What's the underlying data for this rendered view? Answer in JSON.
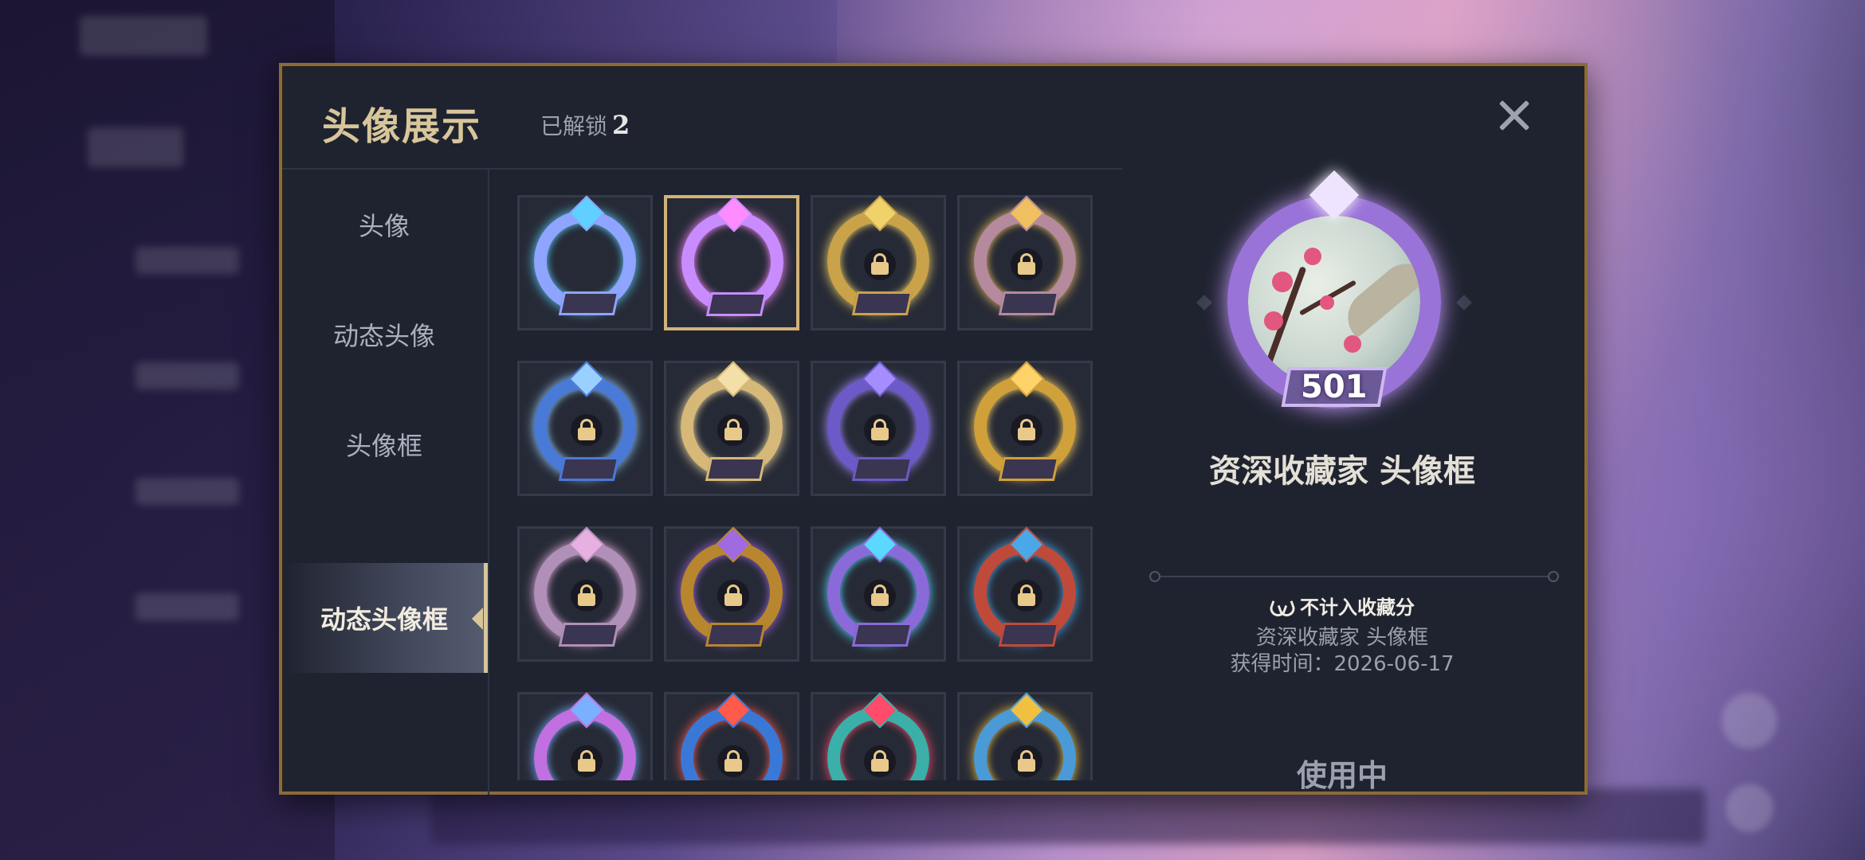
{
  "dialog": {
    "title": "头像展示",
    "unlocked_label": "已解锁",
    "unlocked_count": "2"
  },
  "sidebar": {
    "items": [
      {
        "label": "头像"
      },
      {
        "label": "动态头像"
      },
      {
        "label": "头像框"
      },
      {
        "label": "动态头像框"
      }
    ],
    "active_index": 3
  },
  "grid": {
    "cells": [
      {
        "name": "frame-1",
        "locked": false,
        "selected": false,
        "c1": "#8ea4ff",
        "c2": "#5fd0ff"
      },
      {
        "name": "frame-2",
        "locked": false,
        "selected": true,
        "c1": "#c88cff",
        "c2": "#ff8cff"
      },
      {
        "name": "frame-3",
        "locked": true,
        "c1": "#c9a24a",
        "c2": "#f0d26a"
      },
      {
        "name": "frame-4",
        "locked": true,
        "c1": "#b48a9c",
        "c2": "#f0c060"
      },
      {
        "name": "frame-5",
        "locked": true,
        "c1": "#4a7ad8",
        "c2": "#9ad0ff"
      },
      {
        "name": "frame-6",
        "locked": true,
        "c1": "#d6b878",
        "c2": "#f3e0a8"
      },
      {
        "name": "frame-7",
        "locked": true,
        "c1": "#6b5ac8",
        "c2": "#a58cff"
      },
      {
        "name": "frame-8",
        "locked": true,
        "c1": "#d0a03a",
        "c2": "#ffd36a"
      },
      {
        "name": "frame-9",
        "locked": true,
        "c1": "#b08fb8",
        "c2": "#e8b0e0"
      },
      {
        "name": "frame-10",
        "locked": true,
        "c1": "#b8862e",
        "c2": "#a06ae0"
      },
      {
        "name": "frame-11",
        "locked": true,
        "c1": "#8a6ad8",
        "c2": "#5ad8ff"
      },
      {
        "name": "frame-12",
        "locked": true,
        "c1": "#c04a3a",
        "c2": "#4aa8e8"
      },
      {
        "name": "frame-13",
        "locked": true,
        "c1": "#c070e0",
        "c2": "#7ab0ff"
      },
      {
        "name": "frame-14",
        "locked": true,
        "c1": "#3a78d8",
        "c2": "#ff5a4a"
      },
      {
        "name": "frame-15",
        "locked": true,
        "c1": "#3ab0a8",
        "c2": "#ff4a6a"
      },
      {
        "name": "frame-16",
        "locked": true,
        "c1": "#4a9ad8",
        "c2": "#f0c040"
      }
    ]
  },
  "detail": {
    "level_number": "501",
    "frame_name": "资深收藏家  头像框",
    "badge_text": "不计入收藏分",
    "desc_line1": "资深收藏家  头像框",
    "desc_line2": "获得时间：2026-06-17",
    "status": "使用中"
  },
  "colors": {
    "accent_gold": "#d8c69a",
    "dialog_bg": "#1f2330",
    "border": "#8b6b3a"
  },
  "icons": {
    "close": "close-icon",
    "lock": "lock-icon",
    "badge": "laurel-icon"
  }
}
